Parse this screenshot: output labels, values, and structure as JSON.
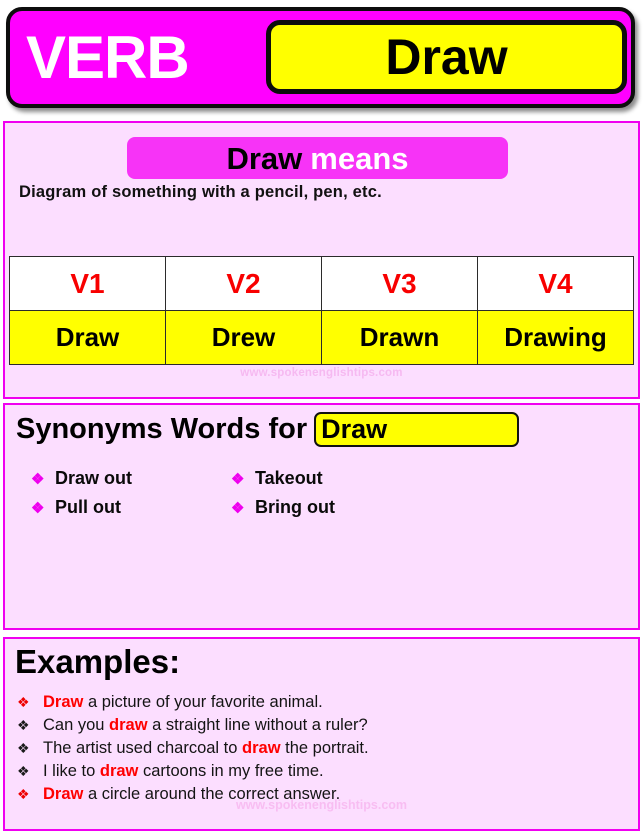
{
  "header": {
    "part_of_speech": "VERB",
    "word": "Draw",
    "bg_color": "#ff00ff",
    "word_box_color": "#ffff00"
  },
  "meaning": {
    "badge_word": "Draw",
    "badge_suffix": "means",
    "definition": "Diagram of something with a pencil, pen, etc."
  },
  "verb_table": {
    "headers": [
      "V1",
      "V2",
      "V3",
      "V4"
    ],
    "forms": [
      "Draw",
      "Drew",
      "Drawn",
      "Drawing"
    ],
    "header_color": "#f80000",
    "row_color": "#ffff00"
  },
  "synonyms": {
    "title": "Synonyms Words for",
    "word": "Draw",
    "items": [
      "Draw out",
      "Takeout",
      "Pull out",
      "Bring out"
    ],
    "bullet_icon": "❖",
    "bullet_color": "#ee00ee"
  },
  "examples": {
    "title": "Examples:",
    "bullet_icon": "❖",
    "items": [
      {
        "before": "",
        "keyword": "Draw",
        "after": " a picture of your favorite animal.",
        "bullet_color": "red"
      },
      {
        "before": "Can you ",
        "keyword": "draw",
        "after": " a straight line without a ruler?",
        "bullet_color": "dark"
      },
      {
        "before": "The artist used charcoal to ",
        "keyword": "draw",
        "after": " the portrait.",
        "bullet_color": "dark"
      },
      {
        "before": "I like to ",
        "keyword": "draw",
        "after": " cartoons in my free time.",
        "bullet_color": "dark"
      },
      {
        "before": "",
        "keyword": "Draw",
        "after": " a circle around the correct answer.",
        "bullet_color": "red"
      }
    ]
  },
  "watermark": "www.spokenenglishtips.com"
}
